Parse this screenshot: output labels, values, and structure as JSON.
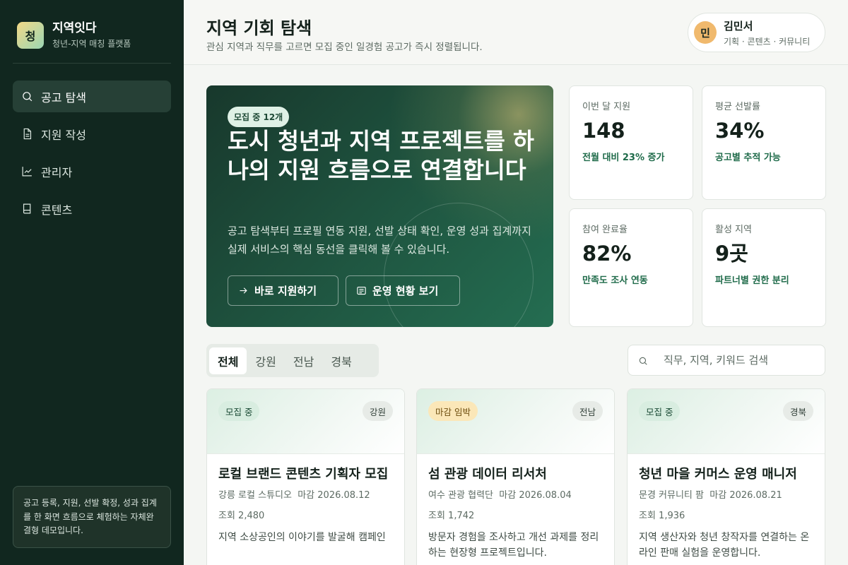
{
  "sidebar": {
    "logo_char": "청",
    "brand_name": "지역잇다",
    "brand_sub": "청년-지역 매칭 플랫폼",
    "items": [
      {
        "label": "공고 탐색",
        "icon": "search-icon",
        "active": true
      },
      {
        "label": "지원 작성",
        "icon": "document-icon",
        "active": false
      },
      {
        "label": "관리자",
        "icon": "chart-icon",
        "active": false
      },
      {
        "label": "콘텐츠",
        "icon": "book-icon",
        "active": false
      }
    ],
    "note": "공고 등록, 지원, 선발 확정, 성과 집계를 한 화면 흐름으로 체험하는 자체완결형 데모입니다."
  },
  "header": {
    "title": "지역 기회 탐색",
    "subtitle": "관심 지역과 직무를 고르면 모집 중인 일경험 공고가 즉시 정렬됩니다.",
    "user": {
      "avatar": "민",
      "name": "김민서",
      "role": "기획 · 콘텐츠 · 커뮤니티"
    }
  },
  "hero": {
    "badge": "모집 중 12개",
    "title": "도시 청년과 지역 프로젝트를 하나의 지원 흐름으로 연결합니다",
    "description": "공고 탐색부터 프로필 연동 지원, 선발 상태 확인, 운영 성과 집계까지 실제 서비스의 핵심 동선을 클릭해 볼 수 있습니다.",
    "primary_button": "바로 지원하기",
    "secondary_button": "운영 현황 보기"
  },
  "stats": [
    {
      "label": "이번 달 지원",
      "value": "148",
      "note": "전월 대비 23% 증가"
    },
    {
      "label": "평균 선발률",
      "value": "34%",
      "note": "공고별 추적 가능"
    },
    {
      "label": "참여 완료율",
      "value": "82%",
      "note": "만족도 조사 연동"
    },
    {
      "label": "활성 지역",
      "value": "9곳",
      "note": "파트너별 권한 분리"
    }
  ],
  "filters": {
    "tabs": [
      "전체",
      "강원",
      "전남",
      "경북"
    ],
    "active_tab": "전체",
    "search_placeholder": "직무, 지역, 키워드 검색"
  },
  "cards": [
    {
      "status": "모집 중",
      "region": "강원",
      "title": "로컬 브랜드 콘텐츠 기획자 모집",
      "org": "강릉 로컬 스튜디오",
      "deadline": "마감 2026.08.12",
      "views": "조회 2,480",
      "description": "지역 소상공인의 이야기를 발굴해 캠페인"
    },
    {
      "status": "마감 임박",
      "region": "전남",
      "title": "섬 관광 데이터 리서처",
      "org": "여수 관광 협력단",
      "deadline": "마감 2026.08.04",
      "views": "조회 1,742",
      "description": "방문자 경험을 조사하고 개선 과제를 정리하는 현장형 프로젝트입니다."
    },
    {
      "status": "모집 중",
      "region": "경북",
      "title": "청년 마을 커머스 운영 매니저",
      "org": "문경 커뮤니티 팜",
      "deadline": "마감 2026.08.21",
      "views": "조회 1,936",
      "description": "지역 생산자와 청년 창작자를 연결하는 온라인 판매 실험을 운영합니다."
    }
  ]
}
